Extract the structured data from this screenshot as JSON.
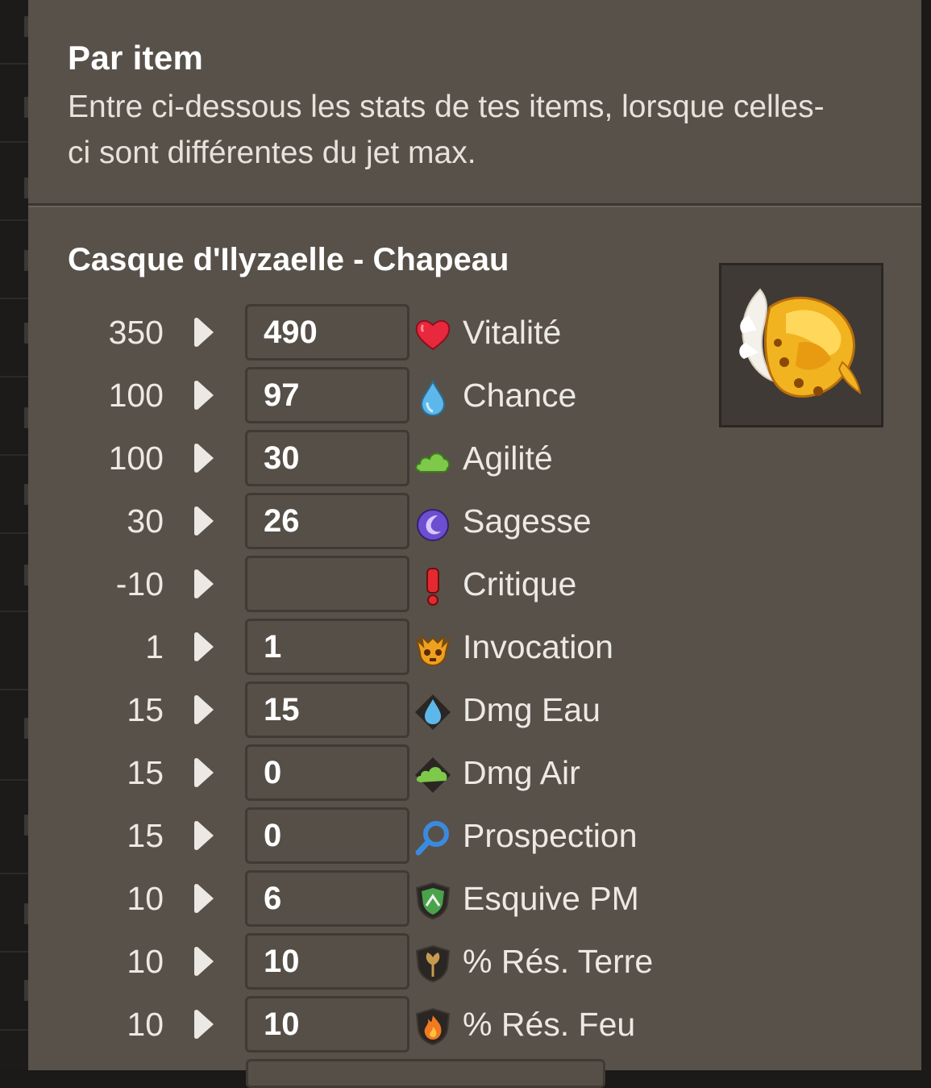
{
  "header": {
    "title": "Par item",
    "description": "Entre ci-dessous les stats de tes items, lorsque celles-ci sont différentes du jet max."
  },
  "item": {
    "name": "Casque d'Ilyzaelle - Chapeau",
    "image_icon": "golden-winged-helmet-icon"
  },
  "stats": [
    {
      "max": "350",
      "value": "490",
      "label": "Vitalité",
      "icon": "heart-icon"
    },
    {
      "max": "100",
      "value": "97",
      "label": "Chance",
      "icon": "water-drop-icon"
    },
    {
      "max": "100",
      "value": "30",
      "label": "Agilité",
      "icon": "air-cloud-icon"
    },
    {
      "max": "30",
      "value": "26",
      "label": "Sagesse",
      "icon": "wisdom-moon-icon"
    },
    {
      "max": "-10",
      "value": "",
      "label": "Critique",
      "icon": "exclamation-icon"
    },
    {
      "max": "1",
      "value": "1",
      "label": "Invocation",
      "icon": "summon-skull-icon"
    },
    {
      "max": "15",
      "value": "15",
      "label": "Dmg Eau",
      "icon": "water-damage-icon"
    },
    {
      "max": "15",
      "value": "0",
      "label": "Dmg Air",
      "icon": "air-damage-icon"
    },
    {
      "max": "15",
      "value": "0",
      "label": "Prospection",
      "icon": "magnifier-icon"
    },
    {
      "max": "10",
      "value": "6",
      "label": "Esquive PM",
      "icon": "dodge-mp-shield-icon"
    },
    {
      "max": "10",
      "value": "10",
      "label": "% Rés. Terre",
      "icon": "earth-resist-shield-icon"
    },
    {
      "max": "10",
      "value": "10",
      "label": "% Rés. Feu",
      "icon": "fire-resist-shield-icon"
    }
  ]
}
